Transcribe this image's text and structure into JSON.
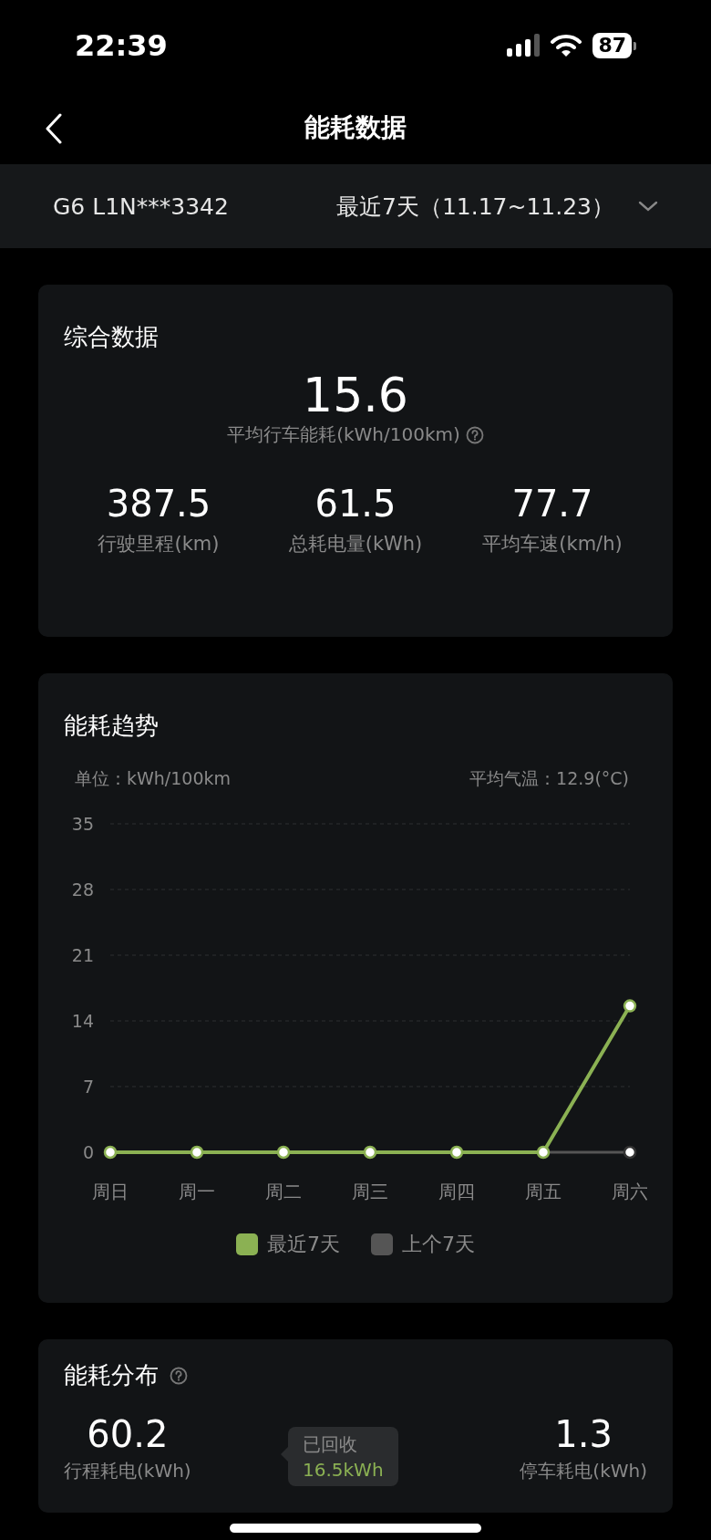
{
  "status_bar": {
    "time": "22:39",
    "battery": "87"
  },
  "nav": {
    "title": "能耗数据"
  },
  "selector": {
    "vehicle": "G6 L1N***3342",
    "period": "最近7天（11.17~11.23）"
  },
  "summary": {
    "title": "综合数据",
    "main_value": "15.6",
    "main_label": "平均行车能耗(kWh/100km)",
    "stats": [
      {
        "value": "387.5",
        "label": "行驶里程(km)"
      },
      {
        "value": "61.5",
        "label": "总耗电量(kWh)"
      },
      {
        "value": "77.7",
        "label": "平均车速(km/h)"
      }
    ]
  },
  "trend": {
    "title": "能耗趋势",
    "unit": "单位：kWh/100km",
    "temperature": "平均气温：12.9(°C)",
    "chart_data": {
      "type": "line",
      "grid": true,
      "categories": [
        "周日",
        "周一",
        "周二",
        "周三",
        "周四",
        "周五",
        "周六"
      ],
      "ylim": [
        0,
        35
      ],
      "yticks": [
        0,
        7,
        14,
        21,
        28,
        35
      ],
      "series": [
        {
          "name": "最近7天",
          "color": "#8bb153",
          "marker": true,
          "values": [
            0,
            0,
            0,
            0,
            0,
            0,
            15.6
          ]
        },
        {
          "name": "上个7天",
          "color": "#555555",
          "marker": true,
          "values": [
            null,
            null,
            null,
            null,
            null,
            0,
            0
          ]
        }
      ]
    }
  },
  "distribution": {
    "title": "能耗分布",
    "stats": [
      {
        "value": "60.2",
        "label": "行程耗电(kWh)"
      },
      {
        "value": "1.3",
        "label": "停车耗电(kWh)"
      }
    ],
    "tooltip": {
      "label": "已回收",
      "value": "16.5kWh"
    }
  }
}
